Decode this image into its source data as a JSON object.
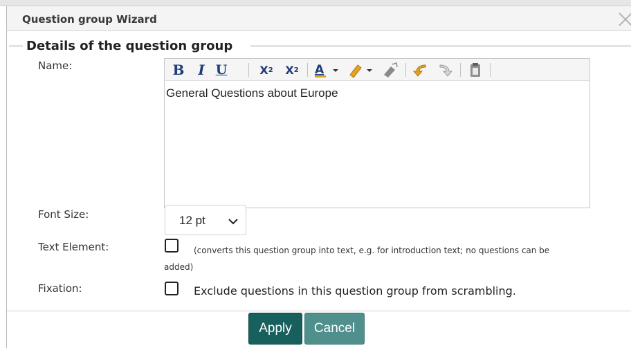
{
  "dialog": {
    "title": "Question group Wizard",
    "close_icon": "close-icon"
  },
  "section": {
    "legend": "Details of the question group"
  },
  "fields": {
    "name_label": "Name:",
    "name_value": "General Questions about Europe",
    "font_size_label": "Font Size:",
    "font_size_value": "12 pt",
    "text_element_label": "Text Element:",
    "text_element_note_line1": "(converts this question group into text, e.g. for introduction text; no questions can be",
    "text_element_note_line2": "added)",
    "text_element_checked": false,
    "fixation_label": "Fixation:",
    "fixation_text": "Exclude questions in this question group from scrambling.",
    "fixation_checked": false
  },
  "toolbar": {
    "bold": "B",
    "italic": "I",
    "underline": "U",
    "subscript": "X",
    "subscript_mark": "2",
    "superscript": "X",
    "superscript_mark": "2",
    "icons": [
      "text-color-icon",
      "highlight-icon",
      "eraser-icon",
      "undo-icon",
      "redo-icon",
      "paste-icon"
    ]
  },
  "buttons": {
    "apply": "Apply",
    "cancel": "Cancel"
  },
  "colors": {
    "apply_bg": "#17605e",
    "cancel_bg": "#4f8f8c",
    "toolbar_icon": "#1f3d7a",
    "accent_gold": "#e3a126"
  }
}
